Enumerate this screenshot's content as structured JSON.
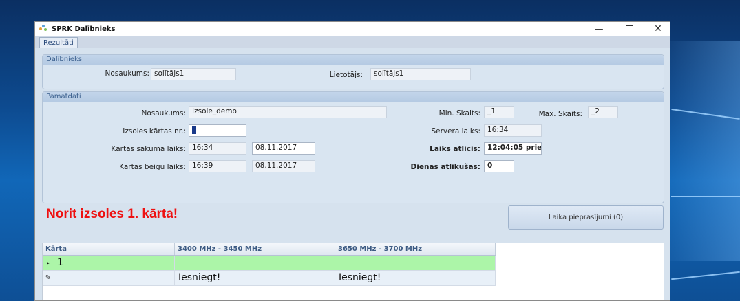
{
  "window": {
    "title": "SPRK Dalībnieks"
  },
  "tabs": [
    {
      "label": "Rezultāti"
    }
  ],
  "participant": {
    "header": "Dalībnieks",
    "name_label": "Nosaukums:",
    "name_value": "solītājs1",
    "user_label": "Lietotājs:",
    "user_value": "solītājs1"
  },
  "basic": {
    "header": "Pamatdati",
    "name_label": "Nosaukums:",
    "name_value": "Izsole_demo",
    "round_label": "Izsoles kārtas nr.:",
    "round_value": "1",
    "start_label": "Kārtas sākuma laiks:",
    "start_time": "16:34",
    "start_date": "08.11.2017",
    "end_label": "Kārtas beigu laiks:",
    "end_time": "16:39",
    "end_date": "08.11.2017",
    "min_label": "Min. Skaits:",
    "min_value": "_1",
    "max_label": "Max. Skaits:",
    "max_value": "_2",
    "server_label": "Servera laiks:",
    "server_value": "16:34",
    "remaining_label": "Laiks atlicis:",
    "remaining_value": "12:04:05 prie",
    "days_label": "Dienas atlikušas:",
    "days_value": "0"
  },
  "status_message": "Norit izsoles 1. kārta!",
  "extension_button": "Laika pieprasījumi (0)",
  "grid": {
    "columns": [
      "Kārta",
      "3400 MHz - 3450 MHz",
      "3650 MHz - 3700 MHz"
    ],
    "rows": [
      {
        "indicator": "▸",
        "round": "1",
        "c1": "",
        "c2": ""
      },
      {
        "indicator": "✎",
        "round": "",
        "c1": "Iesniegt!",
        "c2": "Iesniegt!"
      }
    ]
  },
  "colors": {
    "alert_red": "#ee1111",
    "selected_row": "#acf5a8",
    "group_header": "#3a5f8d"
  }
}
